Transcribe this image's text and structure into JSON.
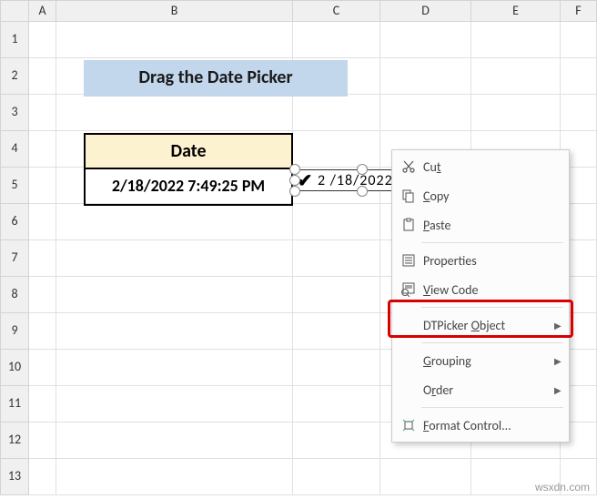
{
  "columns": [
    "A",
    "B",
    "C",
    "D",
    "E",
    "F"
  ],
  "rows": [
    "1",
    "2",
    "3",
    "4",
    "5",
    "6",
    "7",
    "8",
    "9",
    "10",
    "11",
    "12",
    "13"
  ],
  "title": "Drag the Date Picker",
  "date_header": "Date",
  "date_value": "2/18/2022  7:49:25 PM",
  "dtpicker": {
    "value": "2 /18/2022"
  },
  "context_menu": {
    "cut": "Cut",
    "copy": "Copy",
    "paste": "Paste",
    "properties": "Properties",
    "view_code": "View Code",
    "dtpicker_object": "DTPicker Object",
    "grouping": "Grouping",
    "order": "Order",
    "format_control": "Format Control..."
  },
  "watermark": "wsxdn.com"
}
